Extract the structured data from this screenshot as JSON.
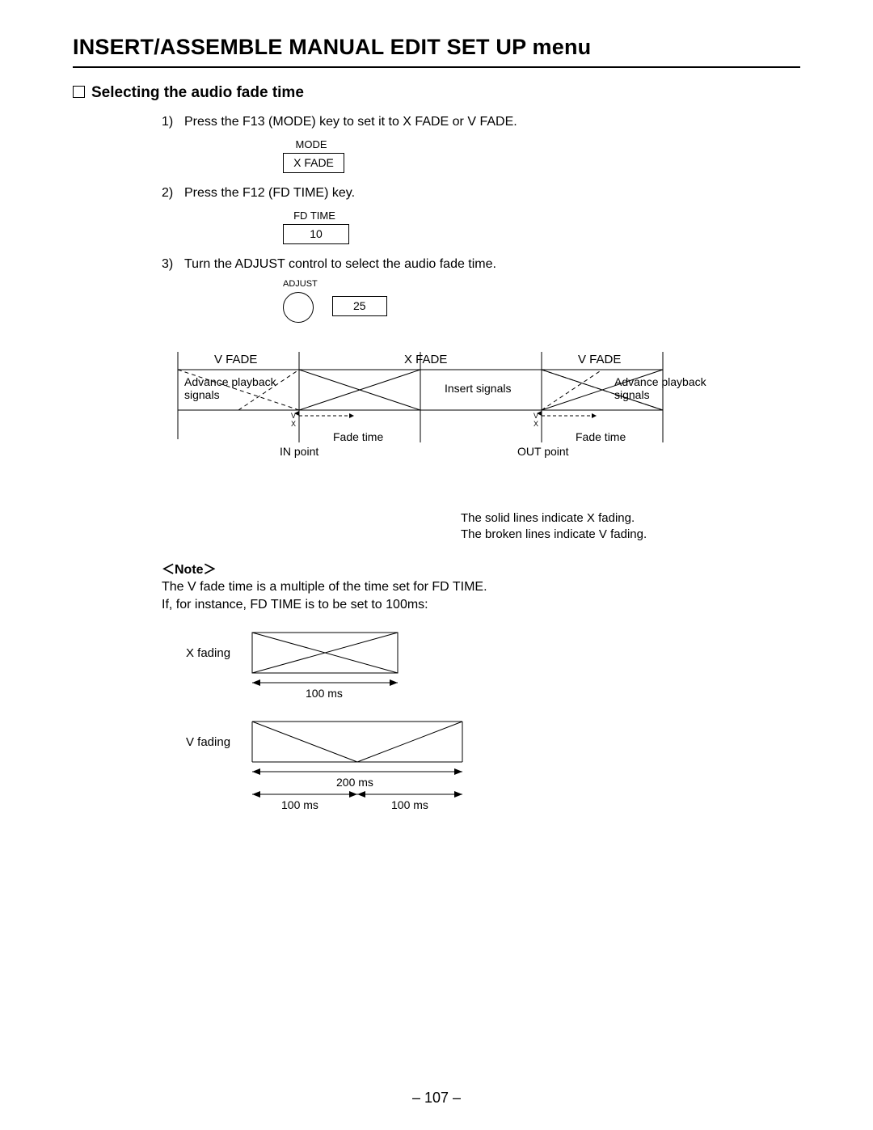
{
  "title": "INSERT/ASSEMBLE MANUAL EDIT SET UP menu",
  "section_heading": "Selecting the audio fade time",
  "steps": {
    "s1": {
      "num": "1)",
      "text": "Press the F13 (MODE) key to set it to X FADE or V FADE."
    },
    "s2": {
      "num": "2)",
      "text": "Press the F12 (FD TIME) key."
    },
    "s3": {
      "num": "3)",
      "text": "Turn the ADJUST control to select the audio fade time."
    }
  },
  "indicators": {
    "mode": {
      "label": "MODE",
      "value": "X FADE"
    },
    "fdtime": {
      "label": "FD TIME",
      "value": "10"
    },
    "adjust": {
      "label": "ADJUST",
      "value": "25"
    }
  },
  "main_diagram": {
    "top": {
      "vfade_left": "V FADE",
      "xfade": "X FADE",
      "vfade_right": "V FADE"
    },
    "left_label": "Advance playback\nsignals",
    "center_label": "Insert signals",
    "right_label": "Advance playback\nsignals",
    "v_small": "V",
    "x_small": "X",
    "fade_time": "Fade time",
    "in_point": "IN point",
    "out_point": "OUT point"
  },
  "legend": {
    "line1": "The solid lines indicate X fading.",
    "line2": "The broken lines indicate V fading."
  },
  "note": {
    "heading": "＜Note＞",
    "line1": "The V fade time is a multiple of the time set for FD TIME.",
    "line2": "If, for instance, FD TIME is to be set to 100ms:"
  },
  "mini": {
    "x_label": "X fading",
    "v_label": "V fading",
    "ms100": "100 ms",
    "ms200": "200 ms"
  },
  "page_number": "– 107 –"
}
